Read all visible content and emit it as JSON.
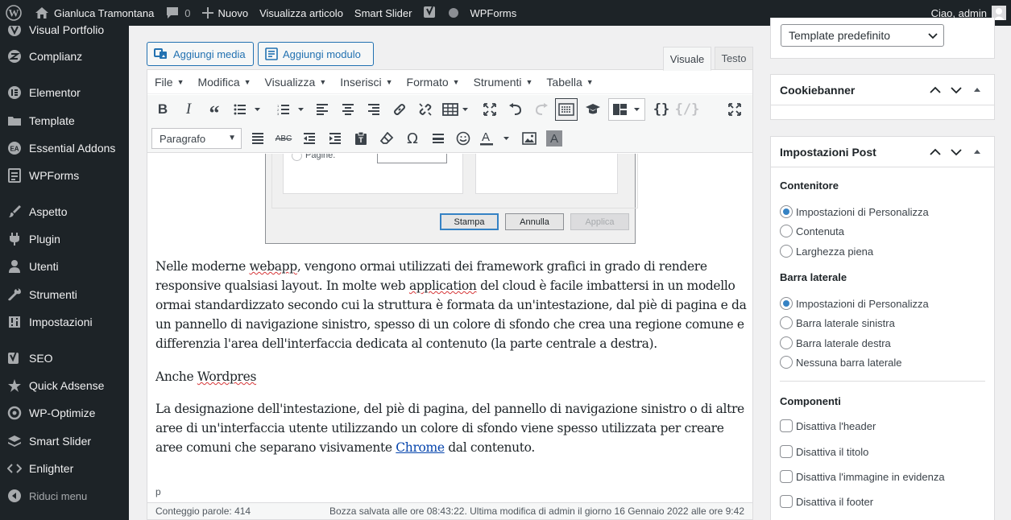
{
  "adminbar": {
    "site_name": "Gianluca Tramontana",
    "comments_count": "0",
    "new_label": "Nuovo",
    "view_post": "Visualizza articolo",
    "smart_slider": "Smart Slider",
    "wpforms": "WPForms",
    "greeting": "Ciao, admin"
  },
  "sidebar": {
    "items": [
      {
        "label": "Visual Portfolio",
        "icon": "portfolio-icon"
      },
      {
        "label": "Complianz",
        "icon": "complianz-icon"
      },
      {
        "label": "Elementor",
        "icon": "elementor-icon"
      },
      {
        "label": "Template",
        "icon": "folder-icon"
      },
      {
        "label": "Essential Addons",
        "icon": "essential-addons-icon"
      },
      {
        "label": "WPForms",
        "icon": "wpforms-icon"
      },
      {
        "label": "Aspetto",
        "icon": "paintbrush-icon"
      },
      {
        "label": "Plugin",
        "icon": "plugin-icon"
      },
      {
        "label": "Utenti",
        "icon": "users-icon"
      },
      {
        "label": "Strumenti",
        "icon": "wrench-icon"
      },
      {
        "label": "Impostazioni",
        "icon": "settings-icon"
      },
      {
        "label": "SEO",
        "icon": "yoast-icon"
      },
      {
        "label": "Quick Adsense",
        "icon": "quick-adsense-icon"
      },
      {
        "label": "WP-Optimize",
        "icon": "wp-optimize-icon"
      },
      {
        "label": "Smart Slider",
        "icon": "smart-slider-icon"
      },
      {
        "label": "Enlighter",
        "icon": "code-icon"
      }
    ],
    "collapse_label": "Riduci menu"
  },
  "editor": {
    "add_media": "Aggiungi media",
    "add_form": "Aggiungi modulo",
    "tab_visual": "Visuale",
    "tab_text": "Testo",
    "menus": [
      "File",
      "Modifica",
      "Visualizza",
      "Inserisci",
      "Formato",
      "Strumenti",
      "Tabella"
    ],
    "format_select": "Paragrafo",
    "dialog": {
      "pages_label": "Pagine:",
      "print_btn": "Stampa",
      "cancel_btn": "Annulla",
      "apply_btn": "Applica"
    },
    "para1": {
      "p1": "Nelle moderne ",
      "w1": "webapp",
      "p2": ", vengono ormai utilizzati dei framework grafici in grado di rendere responsive qualsiasi layout. In molte web ",
      "w2": "application",
      "p3": " del cloud è facile imbattersi in un modello ormai standardizzato secondo cui la struttura è formata da un'intestazione, dal piè di pagina e da un pannello di navigazione sinistro, spesso di un colore di sfondo che crea una regione comune e differenzia l'area dell'interfaccia dedicata al contenuto (la parte centrale a destra)."
    },
    "para2": {
      "p1": "Anche ",
      "w1": "Wordpres"
    },
    "para3": {
      "p1": "La designazione dell'intestazione, del piè di pagina, del pannello di navigazione sinistro o di altre aree di un'interfaccia utente utilizzando un colore di sfondo viene spesso utilizzata per creare aree comuni che separano visivamente ",
      "link": "Chrome",
      "p2": " dal contenuto."
    },
    "path": "p",
    "word_count": "Conteggio parole: 414",
    "saved_status": "Bozza salvata alle ore 08:43:22. Ultima modifica di admin il giorno 16 Gennaio 2022 alle ore 9:42"
  },
  "right": {
    "template_select": "Template predefinito",
    "cookiebanner_title": "Cookiebanner",
    "post_settings_title": "Impostazioni Post",
    "container": {
      "heading": "Contenitore",
      "options": [
        "Impostazioni di Personalizza",
        "Contenuta",
        "Larghezza piena"
      ],
      "selected": 0
    },
    "sidebar_section": {
      "heading": "Barra laterale",
      "options": [
        "Impostazioni di Personalizza",
        "Barra laterale sinistra",
        "Barra laterale destra",
        "Nessuna barra laterale"
      ],
      "selected": 0
    },
    "components": {
      "heading": "Componenti",
      "options": [
        "Disattiva l'header",
        "Disattiva il titolo",
        "Disattiva l'immagine in evidenza",
        "Disattiva il footer"
      ]
    }
  },
  "colors": {
    "adminbar_bg": "#1d2327",
    "accent": "#2271b1",
    "radio_selected": "#3582c4"
  }
}
